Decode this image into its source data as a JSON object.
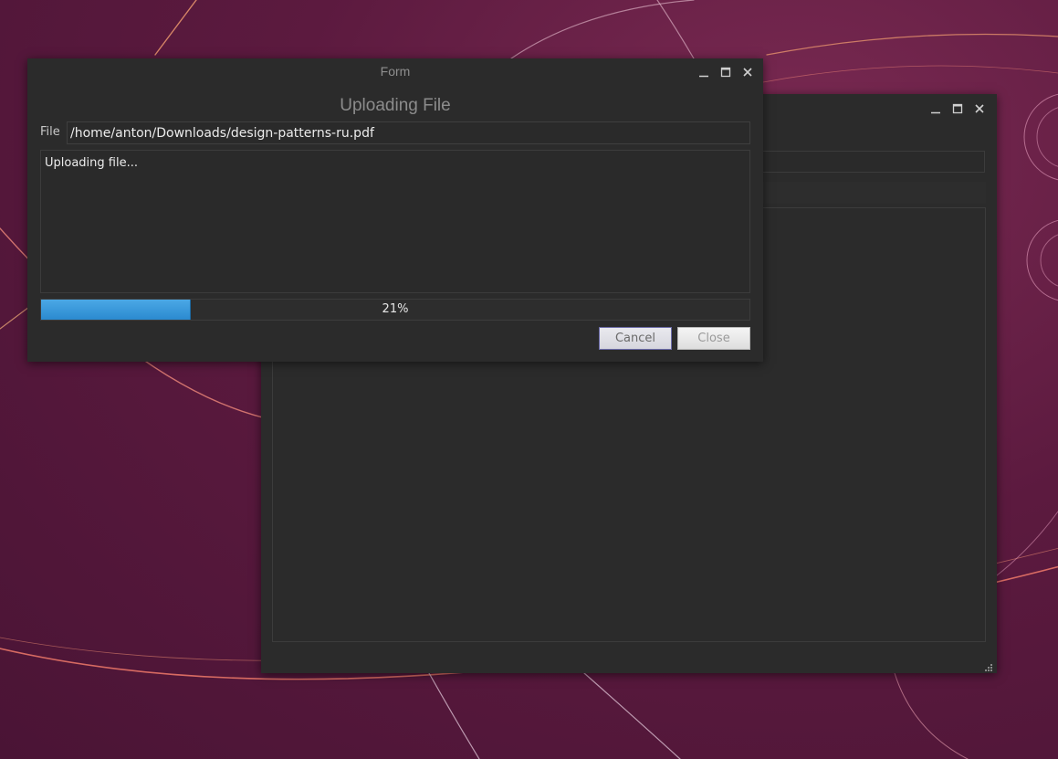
{
  "dialog": {
    "window_title": "Form",
    "heading": "Uploading File",
    "file_label": "File",
    "file_path": "/home/anton/Downloads/design-patterns-ru.pdf",
    "log_text": "Uploading file...",
    "progress": {
      "value": 21,
      "label": "21%"
    },
    "buttons": {
      "cancel": "Cancel",
      "close": "Close"
    }
  },
  "icons": {
    "minimize": "minimize-icon",
    "maximize": "maximize-icon",
    "close": "close-icon",
    "resize_grip": "resize-grip-icon"
  },
  "colors": {
    "window_bg": "#2b2b2b",
    "progress_fill": "#3a9ae0",
    "wallpaper": "#5c1a3f"
  }
}
